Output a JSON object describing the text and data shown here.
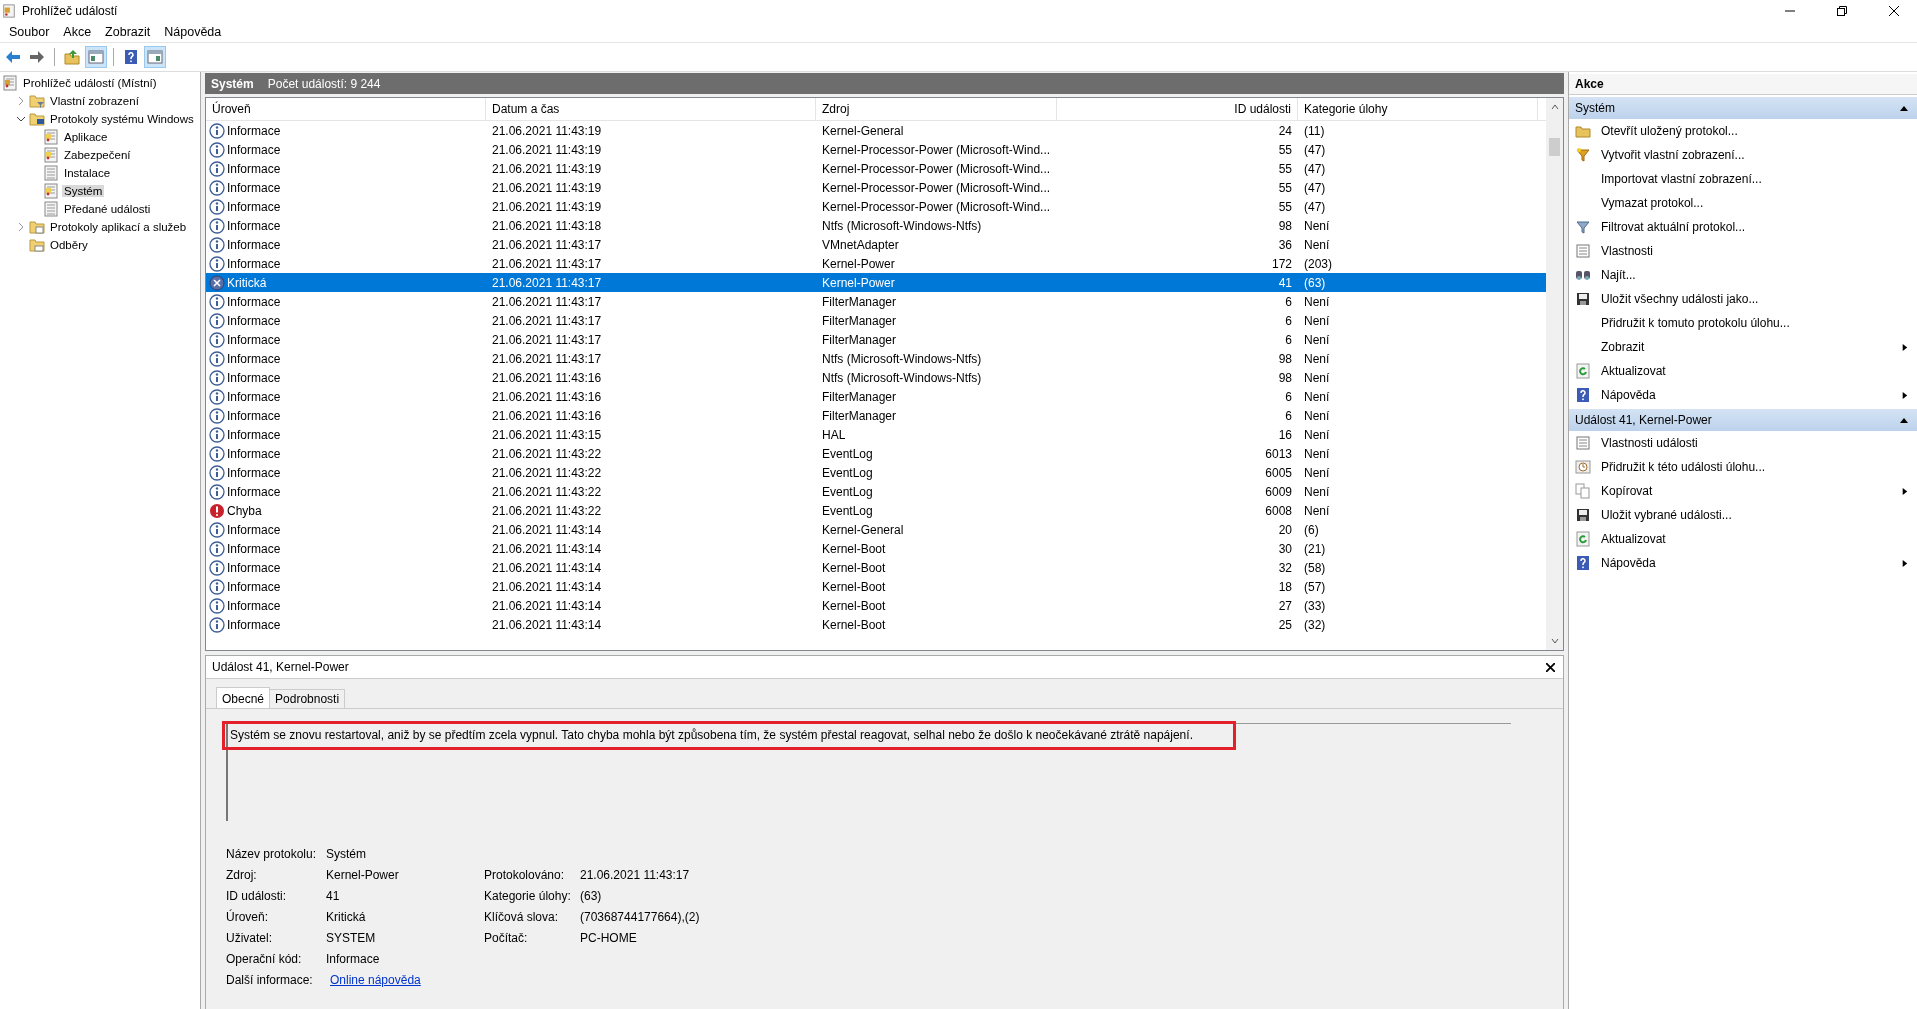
{
  "window": {
    "title": "Prohlížeč událostí"
  },
  "menu": [
    "Soubor",
    "Akce",
    "Zobrazit",
    "Nápověda"
  ],
  "toolbar": [
    {
      "kind": "back",
      "pressed": false
    },
    {
      "kind": "forward",
      "pressed": false
    },
    {
      "kind": "up",
      "pressed": false
    },
    {
      "kind": "tree",
      "pressed": true
    },
    {
      "kind": "help",
      "pressed": false
    },
    {
      "kind": "actions",
      "pressed": true
    }
  ],
  "tree": [
    {
      "label": "Prohlížeč událostí (Místní)",
      "kind": "viewer",
      "selected": false,
      "children": [
        {
          "label": "Vlastní zobrazení",
          "kind": "filterfolder",
          "expanded": false,
          "selected": false
        },
        {
          "label": "Protokoly systému Windows",
          "kind": "pcfolder",
          "expanded": true,
          "selected": false,
          "children": [
            {
              "label": "Aplikace",
              "kind": "log",
              "selected": false
            },
            {
              "label": "Zabezpečení",
              "kind": "log",
              "selected": false
            },
            {
              "label": "Instalace",
              "kind": "plainlog",
              "selected": false
            },
            {
              "label": "Systém",
              "kind": "log",
              "selected": true
            },
            {
              "label": "Předané události",
              "kind": "plainlog",
              "selected": false
            }
          ]
        },
        {
          "label": "Protokoly aplikací a služeb",
          "kind": "folder",
          "expanded": false,
          "selected": false
        },
        {
          "label": "Odběry",
          "kind": "subfolder",
          "selected": false
        }
      ]
    }
  ],
  "log_header": {
    "name": "Systém",
    "count": "Počet událostí: 9 244"
  },
  "table": {
    "columns": [
      "Úroveň",
      "Datum a čas",
      "Zdroj",
      "ID události",
      "Kategorie úlohy"
    ],
    "rows": [
      {
        "kind": "info",
        "level": "Informace",
        "date": "21.06.2021 11:43:19",
        "source": "Kernel-General",
        "id": "24",
        "category": "(11)",
        "selected": false
      },
      {
        "kind": "info",
        "level": "Informace",
        "date": "21.06.2021 11:43:19",
        "source": "Kernel-Processor-Power (Microsoft-Wind...",
        "id": "55",
        "category": "(47)",
        "selected": false
      },
      {
        "kind": "info",
        "level": "Informace",
        "date": "21.06.2021 11:43:19",
        "source": "Kernel-Processor-Power (Microsoft-Wind...",
        "id": "55",
        "category": "(47)",
        "selected": false
      },
      {
        "kind": "info",
        "level": "Informace",
        "date": "21.06.2021 11:43:19",
        "source": "Kernel-Processor-Power (Microsoft-Wind...",
        "id": "55",
        "category": "(47)",
        "selected": false
      },
      {
        "kind": "info",
        "level": "Informace",
        "date": "21.06.2021 11:43:19",
        "source": "Kernel-Processor-Power (Microsoft-Wind...",
        "id": "55",
        "category": "(47)",
        "selected": false
      },
      {
        "kind": "info",
        "level": "Informace",
        "date": "21.06.2021 11:43:18",
        "source": "Ntfs (Microsoft-Windows-Ntfs)",
        "id": "98",
        "category": "Není",
        "selected": false
      },
      {
        "kind": "info",
        "level": "Informace",
        "date": "21.06.2021 11:43:17",
        "source": "VMnetAdapter",
        "id": "36",
        "category": "Není",
        "selected": false
      },
      {
        "kind": "info",
        "level": "Informace",
        "date": "21.06.2021 11:43:17",
        "source": "Kernel-Power",
        "id": "172",
        "category": "(203)",
        "selected": false
      },
      {
        "kind": "critical",
        "level": "Kritická",
        "date": "21.06.2021 11:43:17",
        "source": "Kernel-Power",
        "id": "41",
        "category": "(63)",
        "selected": true
      },
      {
        "kind": "info",
        "level": "Informace",
        "date": "21.06.2021 11:43:17",
        "source": "FilterManager",
        "id": "6",
        "category": "Není",
        "selected": false
      },
      {
        "kind": "info",
        "level": "Informace",
        "date": "21.06.2021 11:43:17",
        "source": "FilterManager",
        "id": "6",
        "category": "Není",
        "selected": false
      },
      {
        "kind": "info",
        "level": "Informace",
        "date": "21.06.2021 11:43:17",
        "source": "FilterManager",
        "id": "6",
        "category": "Není",
        "selected": false
      },
      {
        "kind": "info",
        "level": "Informace",
        "date": "21.06.2021 11:43:17",
        "source": "Ntfs (Microsoft-Windows-Ntfs)",
        "id": "98",
        "category": "Není",
        "selected": false
      },
      {
        "kind": "info",
        "level": "Informace",
        "date": "21.06.2021 11:43:16",
        "source": "Ntfs (Microsoft-Windows-Ntfs)",
        "id": "98",
        "category": "Není",
        "selected": false
      },
      {
        "kind": "info",
        "level": "Informace",
        "date": "21.06.2021 11:43:16",
        "source": "FilterManager",
        "id": "6",
        "category": "Není",
        "selected": false
      },
      {
        "kind": "info",
        "level": "Informace",
        "date": "21.06.2021 11:43:16",
        "source": "FilterManager",
        "id": "6",
        "category": "Není",
        "selected": false
      },
      {
        "kind": "info",
        "level": "Informace",
        "date": "21.06.2021 11:43:15",
        "source": "HAL",
        "id": "16",
        "category": "Není",
        "selected": false
      },
      {
        "kind": "info",
        "level": "Informace",
        "date": "21.06.2021 11:43:22",
        "source": "EventLog",
        "id": "6013",
        "category": "Není",
        "selected": false
      },
      {
        "kind": "info",
        "level": "Informace",
        "date": "21.06.2021 11:43:22",
        "source": "EventLog",
        "id": "6005",
        "category": "Není",
        "selected": false
      },
      {
        "kind": "info",
        "level": "Informace",
        "date": "21.06.2021 11:43:22",
        "source": "EventLog",
        "id": "6009",
        "category": "Není",
        "selected": false
      },
      {
        "kind": "error",
        "level": "Chyba",
        "date": "21.06.2021 11:43:22",
        "source": "EventLog",
        "id": "6008",
        "category": "Není",
        "selected": false
      },
      {
        "kind": "info",
        "level": "Informace",
        "date": "21.06.2021 11:43:14",
        "source": "Kernel-General",
        "id": "20",
        "category": "(6)",
        "selected": false
      },
      {
        "kind": "info",
        "level": "Informace",
        "date": "21.06.2021 11:43:14",
        "source": "Kernel-Boot",
        "id": "30",
        "category": "(21)",
        "selected": false
      },
      {
        "kind": "info",
        "level": "Informace",
        "date": "21.06.2021 11:43:14",
        "source": "Kernel-Boot",
        "id": "32",
        "category": "(58)",
        "selected": false
      },
      {
        "kind": "info",
        "level": "Informace",
        "date": "21.06.2021 11:43:14",
        "source": "Kernel-Boot",
        "id": "18",
        "category": "(57)",
        "selected": false
      },
      {
        "kind": "info",
        "level": "Informace",
        "date": "21.06.2021 11:43:14",
        "source": "Kernel-Boot",
        "id": "27",
        "category": "(33)",
        "selected": false
      },
      {
        "kind": "info",
        "level": "Informace",
        "date": "21.06.2021 11:43:14",
        "source": "Kernel-Boot",
        "id": "25",
        "category": "(32)",
        "selected": false
      }
    ]
  },
  "details": {
    "title": "Událost 41, Kernel-Power",
    "tabs": [
      {
        "label": "Obecné",
        "selected": true
      },
      {
        "label": "Podrobnosti",
        "selected": false
      }
    ],
    "description": "Systém se znovu restartoval, aniž by se předtím zcela vypnul. Tato chyba mohla být způsobena tím, že systém přestal reagovat, selhal nebo že došlo k neočekávané ztrátě napájení.",
    "description_highlighted": true,
    "fields_left": [
      {
        "label": "Název protokolu:",
        "value": "Systém",
        "kind": "text"
      },
      {
        "label": "Zdroj:",
        "value": "Kernel-Power",
        "kind": "text"
      },
      {
        "label": "ID události:",
        "value": "41",
        "kind": "text"
      },
      {
        "label": "Úroveň:",
        "value": "Kritická",
        "kind": "text"
      },
      {
        "label": "Uživatel:",
        "value": "SYSTEM",
        "kind": "text"
      },
      {
        "label": "Operační kód:",
        "value": "Informace",
        "kind": "text"
      },
      {
        "label": "Další informace:",
        "value": "Online nápověda",
        "kind": "link"
      }
    ],
    "fields_right": [
      {
        "label": "Protokolováno:",
        "value": "21.06.2021 11:43:17"
      },
      {
        "label": "Kategorie úlohy:",
        "value": "(63)"
      },
      {
        "label": "Klíčová slova:",
        "value": "(70368744177664),(2)"
      },
      {
        "label": "Počítač:",
        "value": "PC-HOME"
      }
    ]
  },
  "actions": {
    "title": "Akce",
    "sections": [
      {
        "title": "Systém",
        "expanded": true,
        "items": [
          {
            "label": "Otevřít uložený protokol...",
            "kind": "open",
            "submenu": false
          },
          {
            "label": "Vytvořit vlastní zobrazení...",
            "kind": "create",
            "submenu": false
          },
          {
            "label": "Importovat vlastní zobrazení...",
            "kind": "plain",
            "submenu": false
          },
          {
            "label": "Vymazat protokol...",
            "kind": "plain",
            "submenu": false
          },
          {
            "label": "Filtrovat aktuální protokol...",
            "kind": "filter",
            "submenu": false
          },
          {
            "label": "Vlastnosti",
            "kind": "properties",
            "submenu": false
          },
          {
            "label": "Najít...",
            "kind": "find",
            "submenu": false
          },
          {
            "label": "Uložit všechny události jako...",
            "kind": "save",
            "submenu": false
          },
          {
            "label": "Přidružit k tomuto protokolu úlohu...",
            "kind": "plain",
            "submenu": false
          },
          {
            "label": "Zobrazit",
            "kind": "plain",
            "submenu": true
          },
          {
            "label": "Aktualizovat",
            "kind": "refresh",
            "submenu": false
          },
          {
            "label": "Nápověda",
            "kind": "help",
            "submenu": true
          }
        ]
      },
      {
        "title": "Událost 41, Kernel-Power",
        "expanded": true,
        "items": [
          {
            "label": "Vlastnosti události",
            "kind": "properties",
            "submenu": false
          },
          {
            "label": "Přidružit k této události úlohu...",
            "kind": "task",
            "submenu": false
          },
          {
            "label": "Kopírovat",
            "kind": "copy",
            "submenu": true
          },
          {
            "label": "Uložit vybrané události...",
            "kind": "save",
            "submenu": false
          },
          {
            "label": "Aktualizovat",
            "kind": "refresh",
            "submenu": false
          },
          {
            "label": "Nápověda",
            "kind": "help",
            "submenu": true
          }
        ]
      }
    ]
  }
}
